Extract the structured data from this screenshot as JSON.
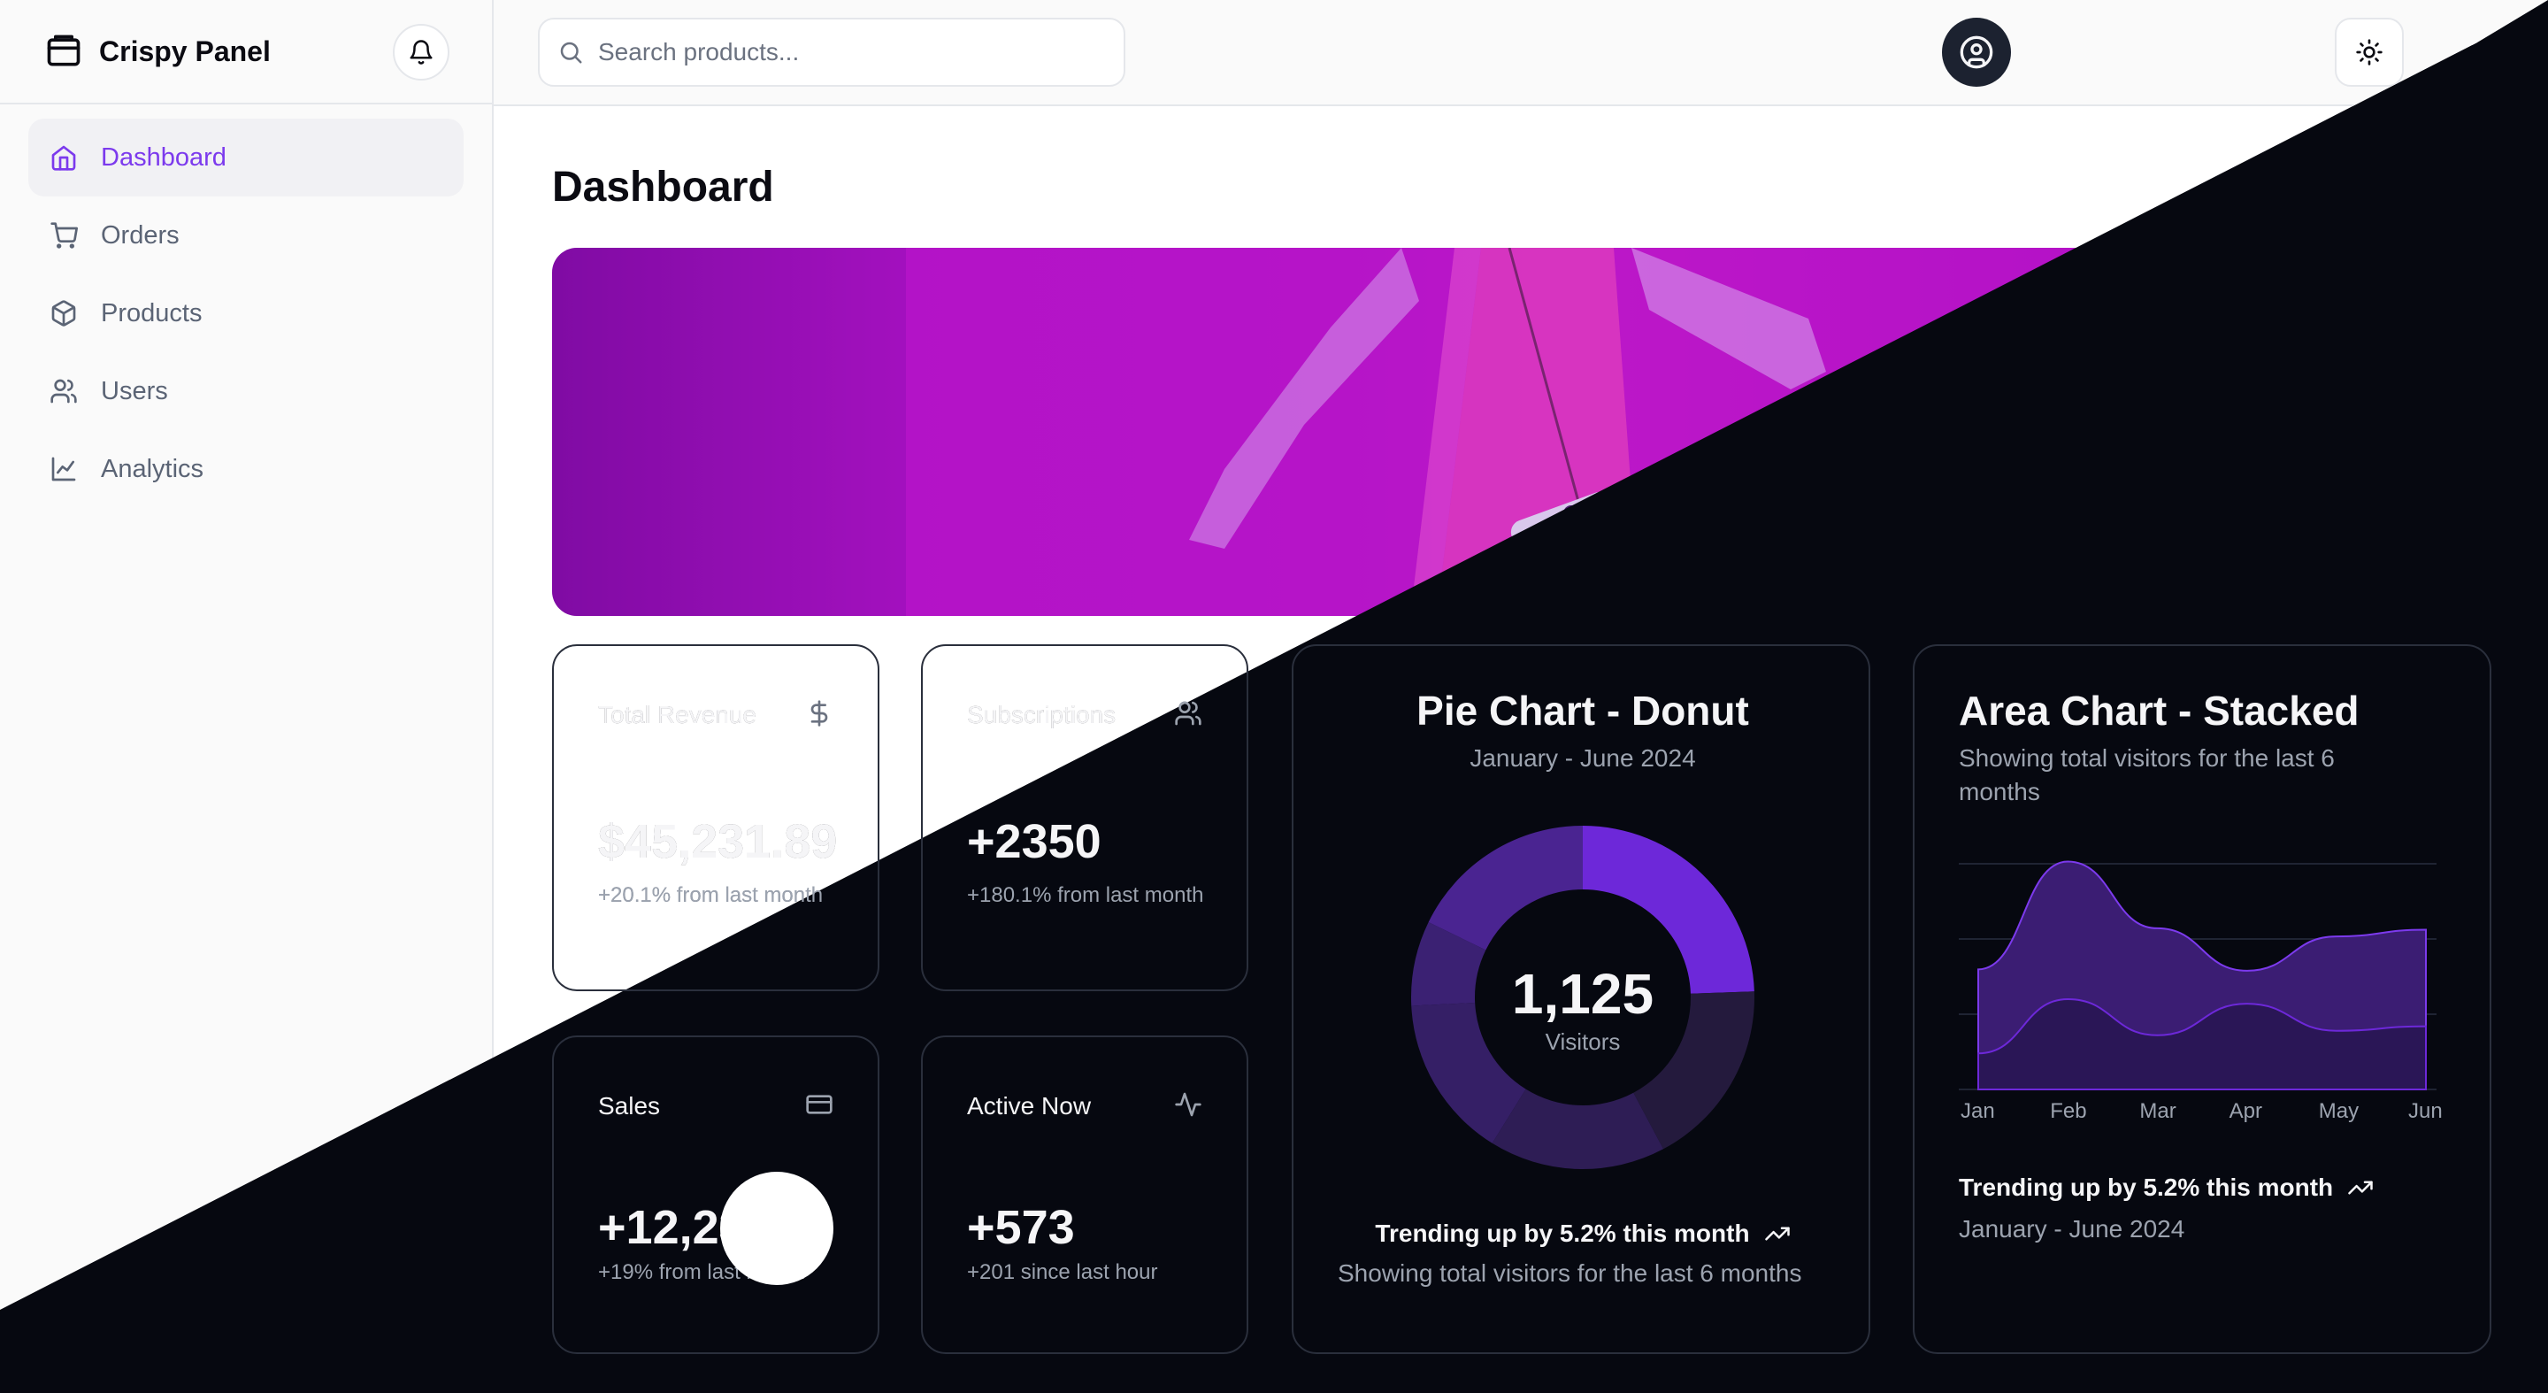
{
  "app": {
    "name": "Crispy Panel"
  },
  "sidebar": {
    "items": [
      {
        "label": "Dashboard",
        "icon": "home-icon",
        "active": true
      },
      {
        "label": "Orders",
        "icon": "cart-icon",
        "active": false
      },
      {
        "label": "Products",
        "icon": "package-icon",
        "active": false
      },
      {
        "label": "Users",
        "icon": "users-icon",
        "active": false
      },
      {
        "label": "Analytics",
        "icon": "line-chart-icon",
        "active": false
      }
    ]
  },
  "header": {
    "search": {
      "placeholder": "Search products...",
      "value": ""
    },
    "icons": [
      "bell-icon",
      "sun-icon",
      "user-avatar-icon"
    ]
  },
  "page": {
    "title": "Dashboard"
  },
  "colors": {
    "accent": "#7c3aed",
    "banner": "#b516c7",
    "dark_bg": "#060810"
  },
  "stats": [
    {
      "title": "Total Revenue",
      "icon": "dollar-icon",
      "value": "$45,231.89",
      "sub": "+20.1% from last month"
    },
    {
      "title": "Subscriptions",
      "icon": "users-icon",
      "value": "+2350",
      "sub": "+180.1% from last month"
    },
    {
      "title": "Sales",
      "icon": "credit-card-icon",
      "value": "+12,234",
      "sub": "+19% from last month"
    },
    {
      "title": "Active Now",
      "icon": "activity-icon",
      "value": "+573",
      "sub": "+201 since last hour"
    }
  ],
  "donut": {
    "title": "Pie Chart - Donut",
    "subtitle": "January - June 2024",
    "center_value": "1,125",
    "center_label": "Visitors",
    "trend": "Trending up by 5.2% this month",
    "footer": "Showing total visitors for the last 6 months"
  },
  "area": {
    "title": "Area Chart - Stacked",
    "subtitle": "Showing total visitors for the last 6 months",
    "trend": "Trending up by 5.2% this month",
    "footer": "January - June 2024"
  },
  "chart_data": [
    {
      "type": "pie",
      "title": "Pie Chart - Donut",
      "subtitle": "January - June 2024",
      "center_value": 1125,
      "values": [
        275,
        200,
        187,
        173,
        90,
        200
      ],
      "colors": [
        "#6d28d9",
        "#241a3d",
        "#2e1d55",
        "#351f66",
        "#3b2173",
        "#4a2491"
      ]
    },
    {
      "type": "area",
      "title": "Area Chart - Stacked",
      "categories": [
        "Jan",
        "Feb",
        "Mar",
        "Apr",
        "May",
        "Jun"
      ],
      "series": [
        {
          "values": [
            80,
            200,
            120,
            190,
            130,
            140
          ]
        },
        {
          "values": [
            186,
            305,
            237,
            73,
            209,
            214
          ]
        }
      ],
      "grid": true
    }
  ]
}
